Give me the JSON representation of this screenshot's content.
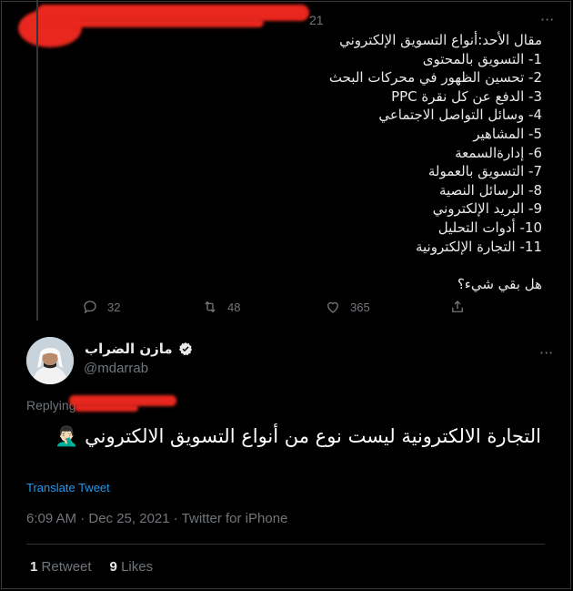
{
  "quoted_tweet": {
    "time_fragment": "21",
    "more_label": "···",
    "text": "مقال الأحد:أنواع التسويق الإلكتروني\n1- التسويق بالمحتوى\n2- تحسين الظهور في محركات البحث\n3- الدفع عن كل نقرة PPC\n4- وسائل التواصل الاجتماعي\n5- المشاهير\n6- إدارةالسمعة\n7- التسويق بالعمولة\n8- الرسائل النصية\n9- البريد الإلكتروني\n10- أدوات التحليل\n11- التجارة الإلكترونية\n\nهل بقي شيء؟",
    "reply_count": "32",
    "retweet_count": "48",
    "like_count": "365",
    "icons": [
      "reply-icon",
      "retweet-icon",
      "like-icon",
      "share-icon"
    ]
  },
  "reply_tweet": {
    "author_name": "مازن الضراب",
    "handle": "@mdarrab",
    "replying_prefix": "Replying",
    "text": "التجارة الالكترونية ليست نوع من أنواع التسويق الالكتروني 🤦🏻‍♂️",
    "translate_label": "Translate Tweet",
    "meta": "6:09 AM · Dec 25, 2021 · Twitter for iPhone",
    "retweets_count": "1",
    "retweets_label": "Retweet",
    "likes_count": "9",
    "likes_label": "Likes",
    "more_label": "···"
  },
  "colors": {
    "background": "#000000",
    "text": "#e7e9ea",
    "muted": "#71767b",
    "link": "#1d9bf0",
    "redaction": "#e8271e"
  }
}
